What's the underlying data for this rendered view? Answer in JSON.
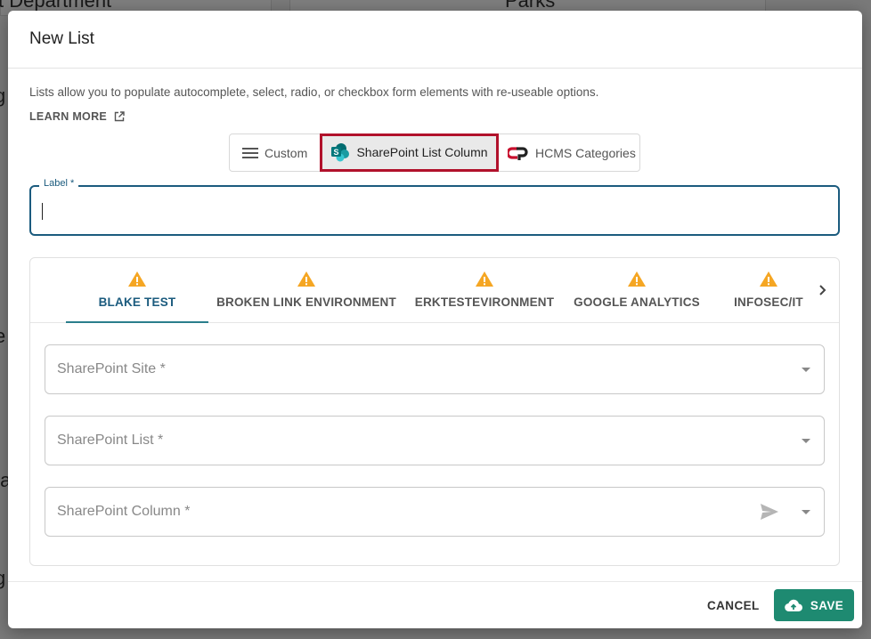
{
  "background": {
    "left_title": "t Department",
    "center_title": "Parks",
    "side_fragments": [
      "g",
      "e",
      "ta",
      "g"
    ]
  },
  "modal": {
    "title": "New List",
    "description": "Lists allow you to populate autocomplete, select, radio, or checkbox form elements with re-useable options.",
    "learn_more": "LEARN MORE",
    "source_toggle": [
      {
        "label": "Custom",
        "icon": "list-icon",
        "selected": false
      },
      {
        "label": "SharePoint List Column",
        "icon": "sharepoint-icon",
        "selected": true
      },
      {
        "label": "HCMS Categories",
        "icon": "hcms-logo-icon",
        "selected": false
      }
    ],
    "label_field": {
      "label": "Label *",
      "value": ""
    },
    "environment_tabs": [
      {
        "label": "BLAKE TEST",
        "icon": "warning-icon",
        "active": true
      },
      {
        "label": "BROKEN LINK ENVIRONMENT",
        "icon": "warning-icon",
        "active": false
      },
      {
        "label": "ERKTESTEVIRONMENT",
        "icon": "warning-icon",
        "active": false
      },
      {
        "label": "GOOGLE ANALYTICS",
        "icon": "warning-icon",
        "active": false
      },
      {
        "label": "INFOSEC/IT",
        "icon": "warning-icon",
        "active": false
      }
    ],
    "fields": {
      "site_placeholder": "SharePoint Site *",
      "list_placeholder": "SharePoint List *",
      "column_placeholder": "SharePoint Column *"
    },
    "footer": {
      "cancel": "CANCEL",
      "save": "SAVE"
    }
  },
  "colors": {
    "accent": "#1b5b7e",
    "selected_outline": "#b1112b",
    "save_button": "#1e8a71",
    "warning": "#f5a623"
  }
}
